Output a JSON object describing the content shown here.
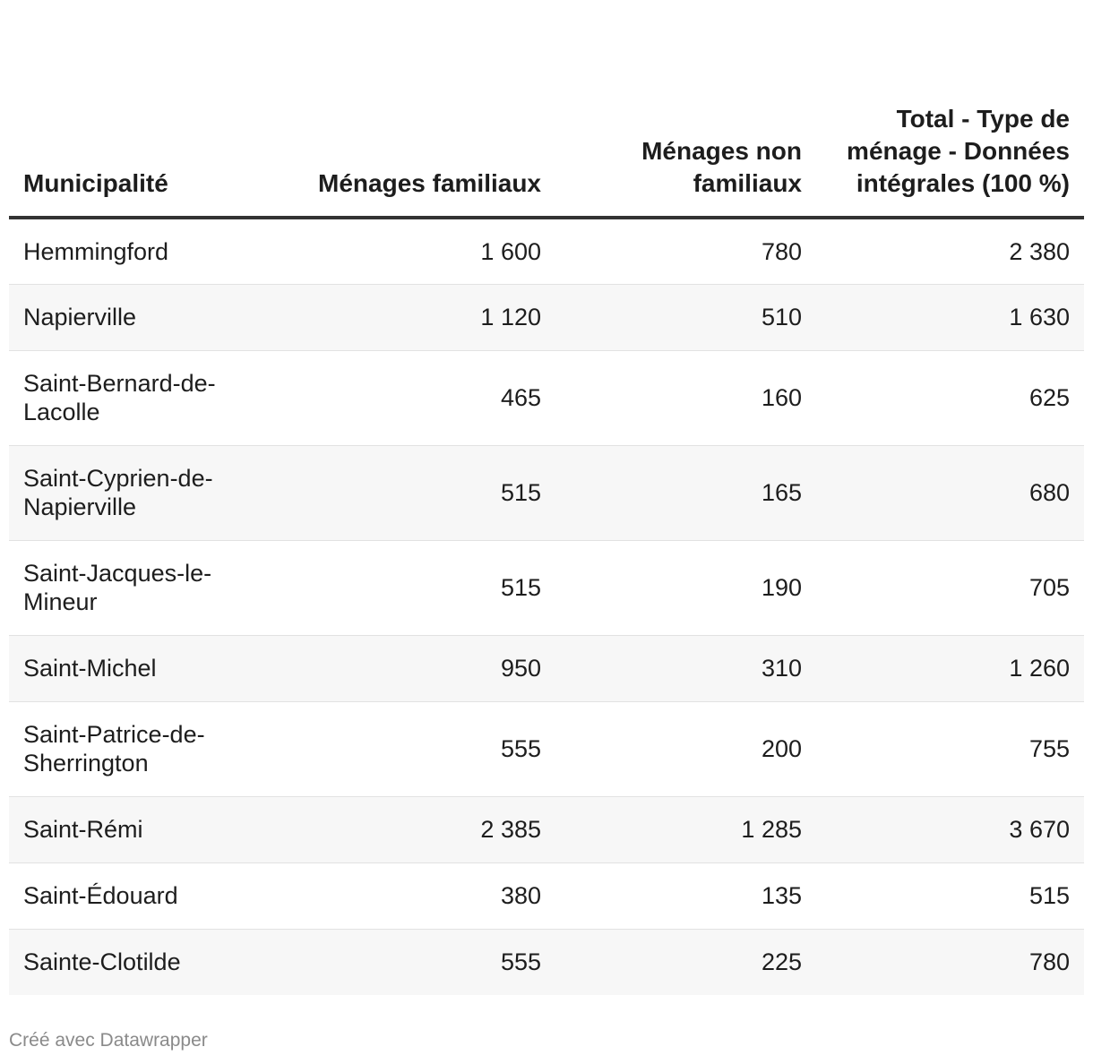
{
  "chart_data": {
    "type": "table",
    "columns": [
      "Municipalité",
      "Ménages familiaux",
      "Ménages non familiaux",
      "Total - Type de ménage - Données intégrales (100 %)"
    ],
    "rows": [
      [
        "Hemmingford",
        "1 600",
        "780",
        "2 380"
      ],
      [
        "Napierville",
        "1 120",
        "510",
        "1 630"
      ],
      [
        "Saint-Bernard-de-Lacolle",
        "465",
        "160",
        "625"
      ],
      [
        "Saint-Cyprien-de-Napierville",
        "515",
        "165",
        "680"
      ],
      [
        "Saint-Jacques-le-Mineur",
        "515",
        "190",
        "705"
      ],
      [
        "Saint-Michel",
        "950",
        "310",
        "1 260"
      ],
      [
        "Saint-Patrice-de-Sherrington",
        "555",
        "200",
        "755"
      ],
      [
        "Saint-Rémi",
        "2 385",
        "1 285",
        "3 670"
      ],
      [
        "Saint-Édouard",
        "380",
        "135",
        "515"
      ],
      [
        "Sainte-Clotilde",
        "555",
        "225",
        "780"
      ]
    ]
  },
  "footer": {
    "credit": "Créé avec Datawrapper"
  }
}
